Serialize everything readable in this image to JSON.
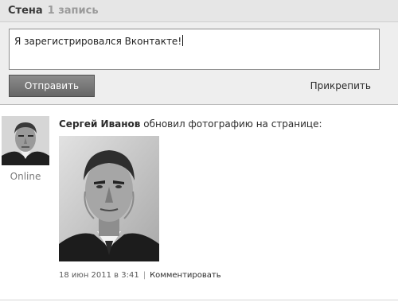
{
  "wall": {
    "title": "Стена",
    "count": "1 запись"
  },
  "compose": {
    "input_value": "Я зарегистрировался Вконтакте!",
    "send_label": "Отправить",
    "attach_label": "Прикрепить"
  },
  "post": {
    "author": "Сергей Иванов",
    "action": "обновил фотографию на странице:",
    "status": "Online",
    "date": "18 июн 2011 в 3:41",
    "separator": "|",
    "comment_label": "Комментировать"
  }
}
